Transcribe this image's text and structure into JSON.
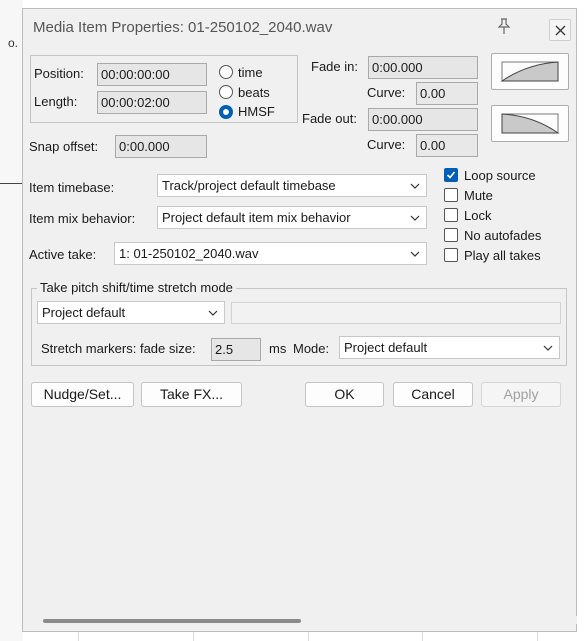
{
  "background": {
    "stray_text": "o."
  },
  "dialog": {
    "title": "Media Item Properties:  01-250102_2040.wav",
    "position": {
      "label": "Position:",
      "value": "00:00:00:00"
    },
    "length": {
      "label": "Length:",
      "value": "00:00:02:00"
    },
    "time_format": {
      "options": [
        "time",
        "beats",
        "HMSF"
      ],
      "selected": "HMSF"
    },
    "fade_in": {
      "label": "Fade in:",
      "value": "0:00.000",
      "curve_label": "Curve:",
      "curve_value": "0.00"
    },
    "fade_out": {
      "label": "Fade out:",
      "value": "0:00.000",
      "curve_label": "Curve:",
      "curve_value": "0.00"
    },
    "snap_offset": {
      "label": "Snap offset:",
      "value": "0:00.000"
    },
    "item_timebase": {
      "label": "Item timebase:",
      "value": "Track/project default timebase"
    },
    "item_mix": {
      "label": "Item mix behavior:",
      "value": "Project default item mix behavior"
    },
    "active_take": {
      "label": "Active take:",
      "value": "1: 01-250102_2040.wav"
    },
    "checkboxes": [
      {
        "label": "Loop source",
        "checked": true
      },
      {
        "label": "Mute",
        "checked": false
      },
      {
        "label": "Lock",
        "checked": false
      },
      {
        "label": "No autofades",
        "checked": false
      },
      {
        "label": "Play all takes",
        "checked": false
      }
    ],
    "pitch_group": {
      "title": "Take pitch shift/time stretch mode",
      "mode_value": "Project default",
      "submode_value": "",
      "stretch_label": "Stretch markers: fade size:",
      "fade_size": "2.5",
      "unit": "ms",
      "mode_label": "Mode:",
      "stretch_mode_value": "Project default"
    },
    "buttons": {
      "nudge": "Nudge/Set...",
      "take_fx": "Take FX...",
      "ok": "OK",
      "cancel": "Cancel",
      "apply": "Apply"
    },
    "colors": {
      "accent": "#005fb8",
      "dialog_bg": "#f0f0f0"
    }
  }
}
